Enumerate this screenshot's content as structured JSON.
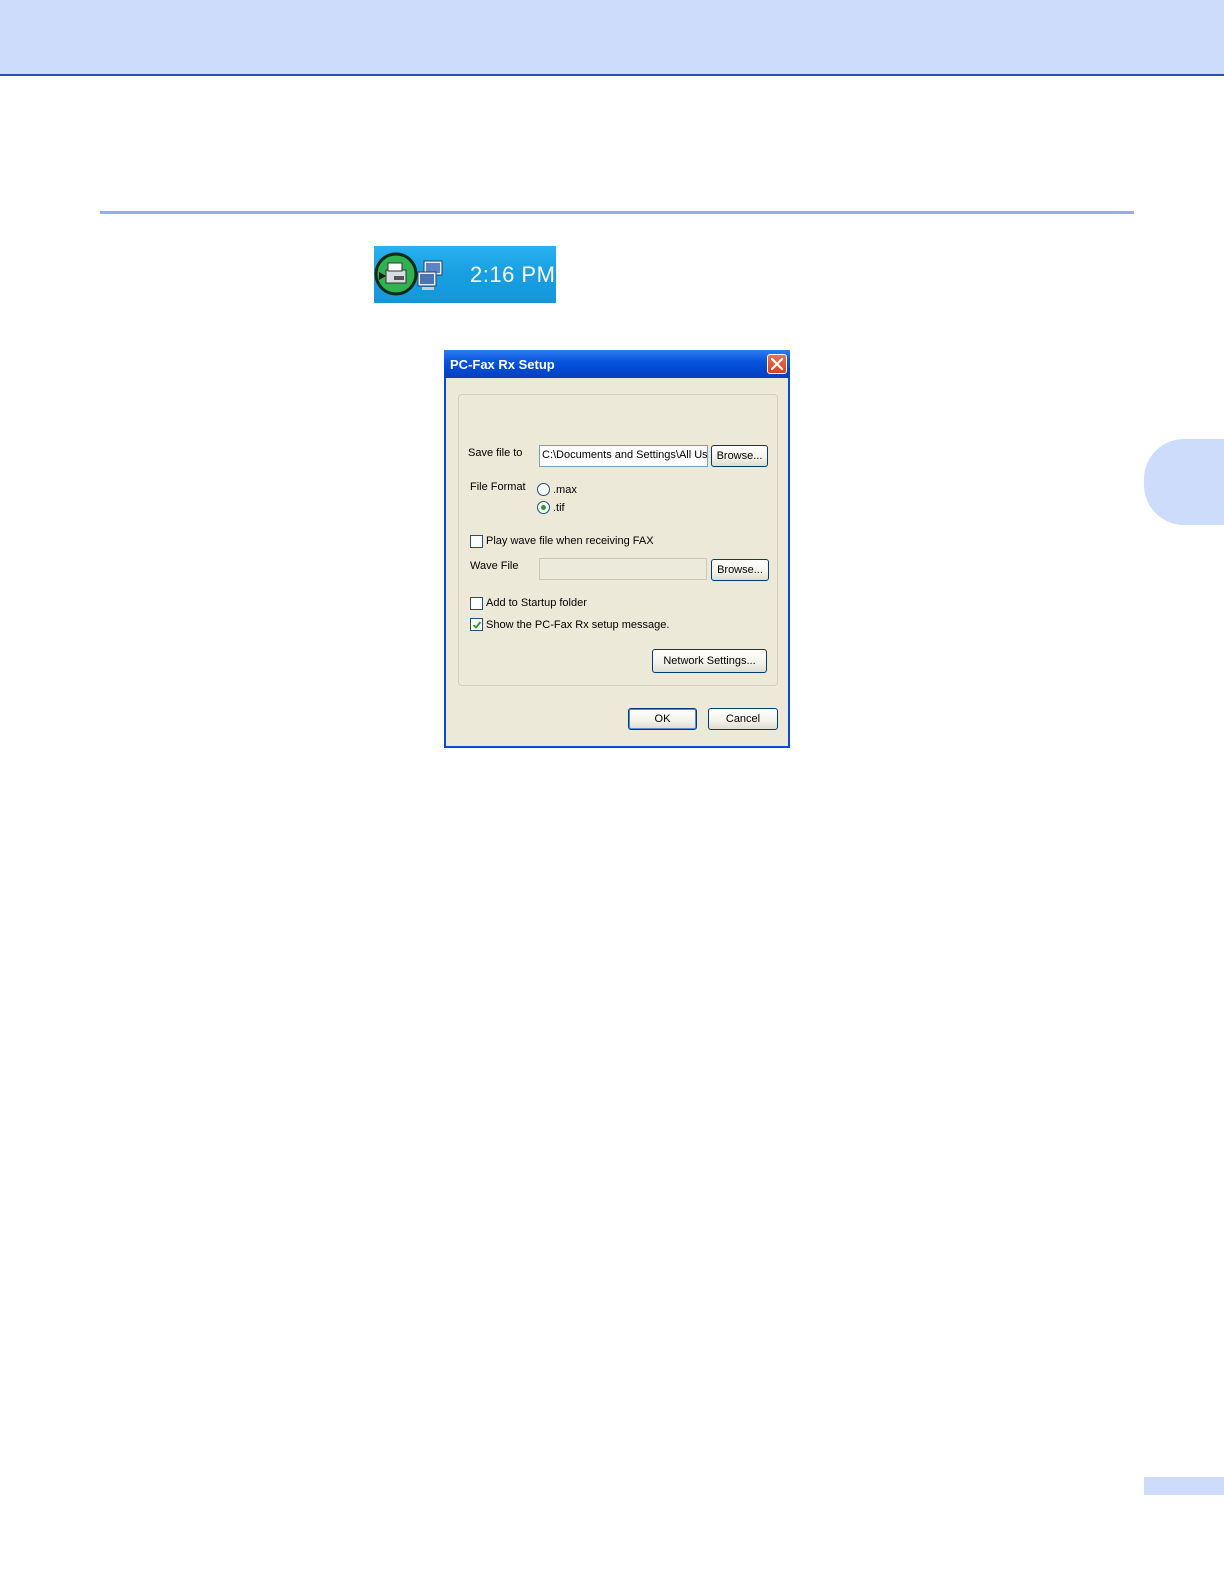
{
  "tray": {
    "clock": "2:16 PM",
    "icons": [
      "fax-receive-icon",
      "network-icon"
    ]
  },
  "dialog": {
    "title": "PC-Fax Rx Setup",
    "save_file_to": {
      "label": "Save file to",
      "value": "C:\\Documents and Settings\\All Use",
      "browse_label": "Browse..."
    },
    "file_format": {
      "label": "File Format",
      "options": [
        {
          "label": ".max",
          "selected": false
        },
        {
          "label": ".tif",
          "selected": true
        }
      ]
    },
    "play_wave": {
      "label": "Play wave file when receiving FAX",
      "checked": false
    },
    "wave_file": {
      "label": "Wave File",
      "value": "",
      "browse_label": "Browse..."
    },
    "add_startup": {
      "label": "Add to Startup folder",
      "checked": false
    },
    "show_setup_message": {
      "label": "Show the PC-Fax Rx setup message.",
      "checked": true
    },
    "network_settings_label": "Network Settings...",
    "ok_label": "OK",
    "cancel_label": "Cancel"
  },
  "colors": {
    "header_band": "#cddcfb",
    "titlebar": "#0855dd",
    "dialog_face": "#ece9d8"
  }
}
